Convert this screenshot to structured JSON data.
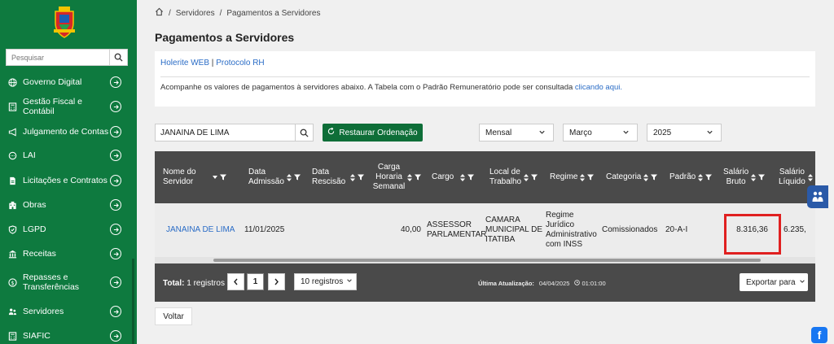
{
  "sidebar": {
    "search_placeholder": "Pesquisar",
    "items": [
      {
        "label": "Governo Digital",
        "icon": "globe-icon"
      },
      {
        "label": "Gestão Fiscal e Contábil",
        "icon": "calculator-icon"
      },
      {
        "label": "Julgamento de Contas",
        "icon": "megaphone-icon"
      },
      {
        "label": "LAI",
        "icon": "chat-icon"
      },
      {
        "label": "Licitações e Contratos",
        "icon": "document-icon"
      },
      {
        "label": "Obras",
        "icon": "building-icon"
      },
      {
        "label": "LGPD",
        "icon": "shield-icon"
      },
      {
        "label": "Receitas",
        "icon": "bank-icon"
      },
      {
        "label": "Repasses e Transferências",
        "icon": "transfer-icon"
      },
      {
        "label": "Servidores",
        "icon": "users-icon"
      },
      {
        "label": "SIAFIC",
        "icon": "calculator-icon"
      }
    ]
  },
  "breadcrumb": {
    "items": [
      "Servidores",
      "Pagamentos a Servidores"
    ]
  },
  "page": {
    "title": "Pagamentos a Servidores"
  },
  "info": {
    "link1": "Holerite WEB",
    "separator": "|",
    "link2": "Protocolo RH",
    "text": "Acompanhe os valores de pagamentos à servidores abaixo. A Tabela com o Padrão Remuneratório pode ser consultada",
    "text_link": "clicando aqui."
  },
  "filters": {
    "search_value": "JANAINA DE LIMA",
    "restore_label": "Restaurar Ordenação",
    "period": "Mensal",
    "month": "Março",
    "year": "2025"
  },
  "table": {
    "headers": {
      "nome": [
        "Nome do",
        "Servidor"
      ],
      "admissao": [
        "Data",
        "Admissão"
      ],
      "rescisao": [
        "Data",
        "Rescisão"
      ],
      "carga": [
        "Carga",
        "Horaria",
        "Semanal"
      ],
      "cargo": [
        "Cargo"
      ],
      "local": [
        "Local de",
        "Trabalho"
      ],
      "regime": [
        "Regime"
      ],
      "categoria": [
        "Categoria"
      ],
      "padrao": [
        "Padrão"
      ],
      "bruto": [
        "Salário",
        "Bruto"
      ],
      "liquido": [
        "Salário",
        "Líquido"
      ]
    },
    "row": {
      "nome": "JANAINA DE LIMA",
      "admissao": "11/01/2025",
      "rescisao": "",
      "carga": "40,00",
      "cargo": [
        "ASSESSOR",
        "PARLAMENTAR"
      ],
      "local": [
        "CAMARA",
        "MUNICIPAL DE",
        "ITATIBA"
      ],
      "regime": [
        "Regime",
        "Jurídico",
        "Administrativo",
        "com INSS"
      ],
      "categoria": "Comissionados",
      "padrao": "20-A-I",
      "bruto": "8.316,36",
      "liquido": "6.235,"
    }
  },
  "footer": {
    "total_label": "Total:",
    "total_value": "1 registros",
    "current_page": "1",
    "per_page": "10 registros",
    "update_label": "Última Atualização:",
    "update_date": "04/04/2025",
    "update_time": "01:01:00",
    "export_label": "Exportar para"
  },
  "back_label": "Voltar",
  "colors": {
    "sidebar": "#0e7a3f",
    "primary_button": "#0e6e38",
    "table_header": "#4a4a4a",
    "link": "#2a6cc6",
    "highlight": "#e02020"
  }
}
